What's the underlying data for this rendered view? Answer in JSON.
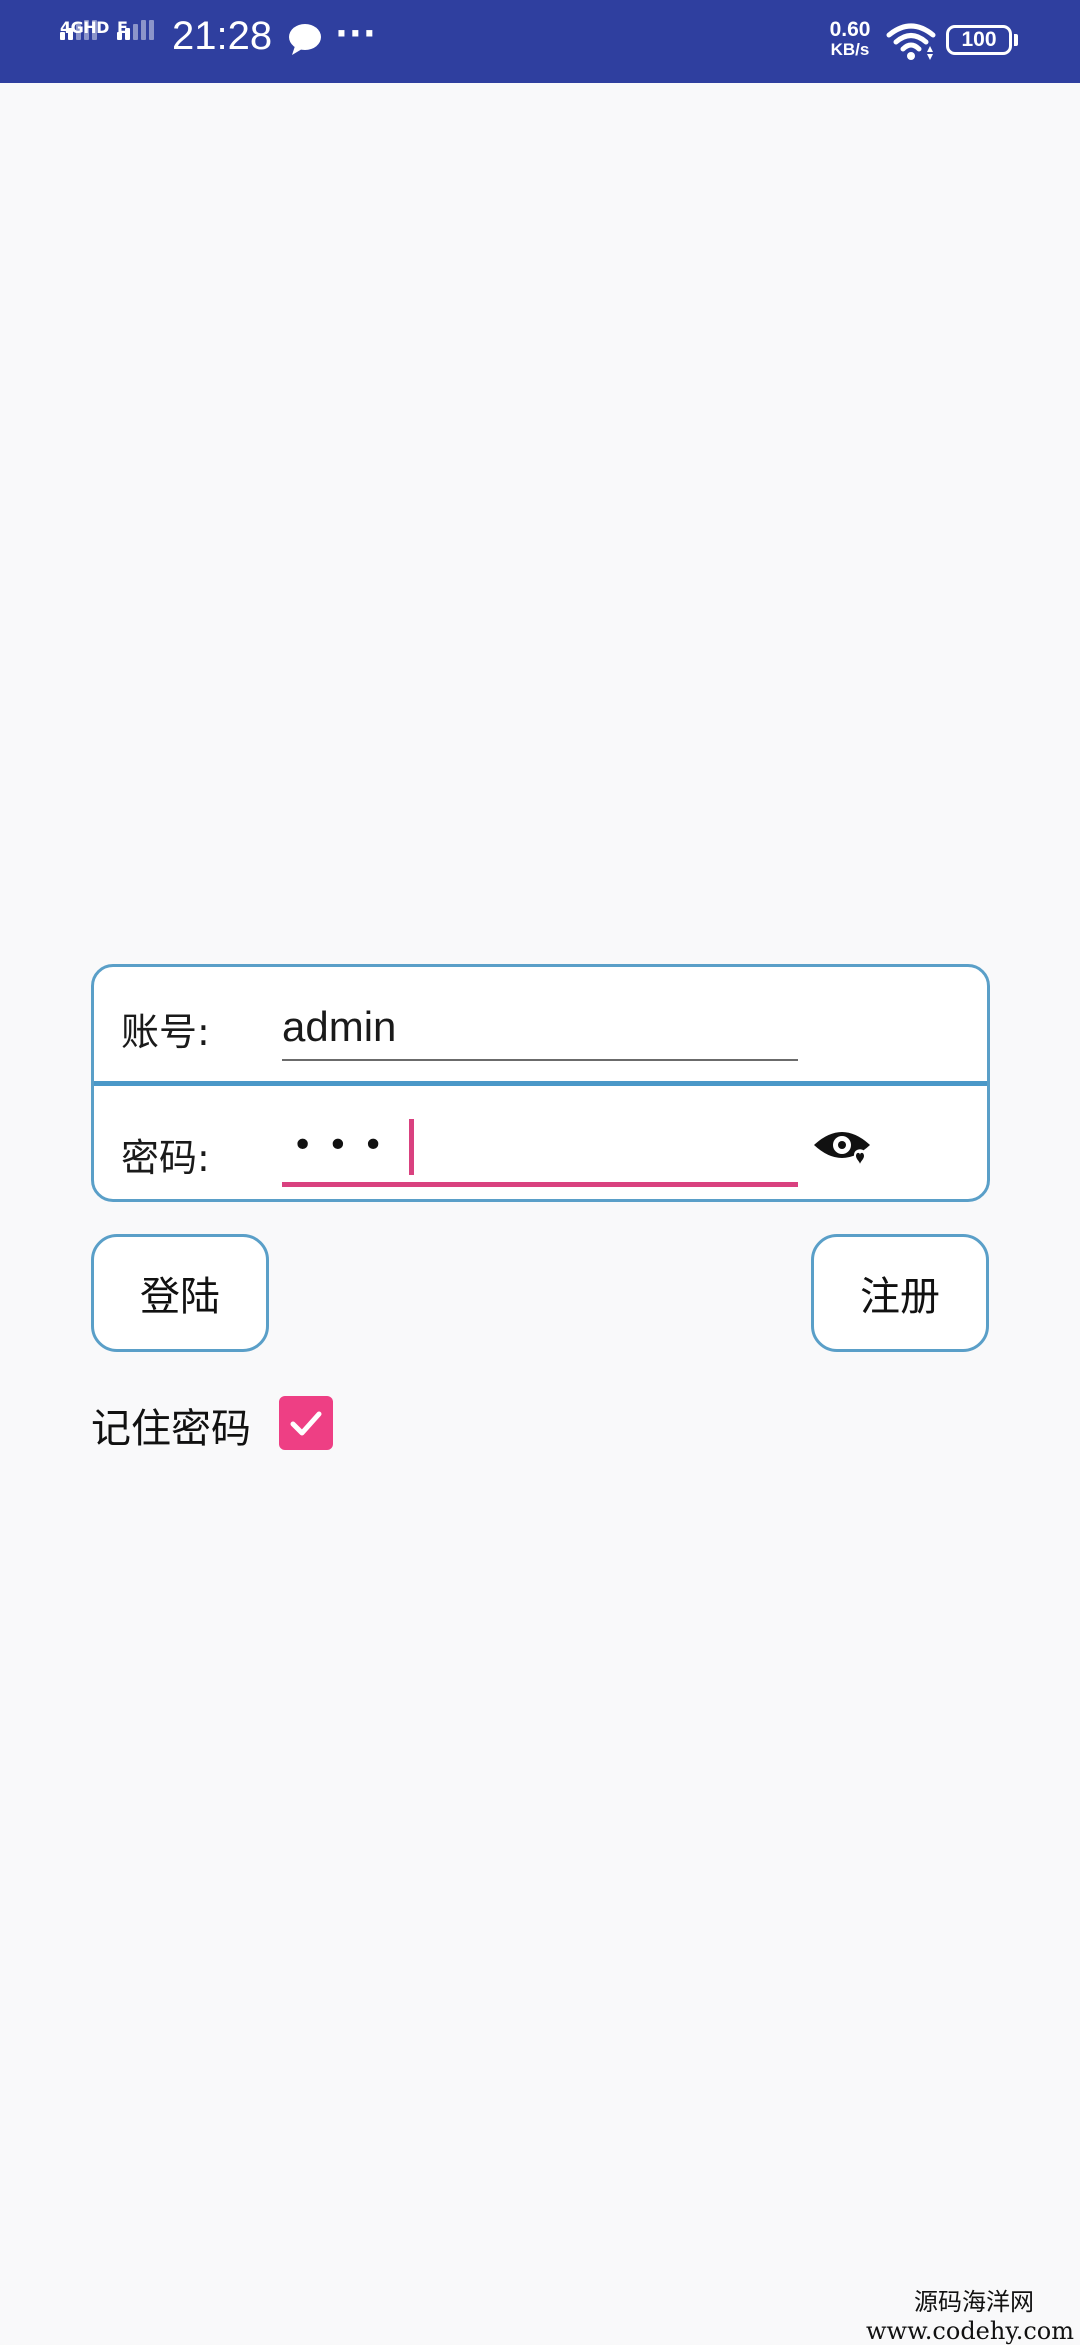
{
  "status_bar": {
    "network1": "4GHD",
    "network2": "E",
    "time": "21:28",
    "net_speed_value": "0.60",
    "net_speed_unit": "KB/s",
    "battery": "100",
    "icons": [
      "signal-icon",
      "message-icon",
      "more-icon",
      "wifi-icon",
      "battery-icon"
    ]
  },
  "form": {
    "account_label": "账号:",
    "account_value": "admin",
    "password_label": "密码:",
    "password_masked": "•••",
    "password_visibility_icon": "eye-icon"
  },
  "buttons": {
    "login": "登陆",
    "register": "注册"
  },
  "remember": {
    "label": "记住密码",
    "checked": true
  },
  "watermark": {
    "line1": "源码海洋网",
    "line2": "www.codehy.com"
  },
  "colors": {
    "status_bar": "#2f3f9f",
    "border": "#5a9fc8",
    "accent": "#d9417f",
    "checkbox": "#ee3f84"
  }
}
